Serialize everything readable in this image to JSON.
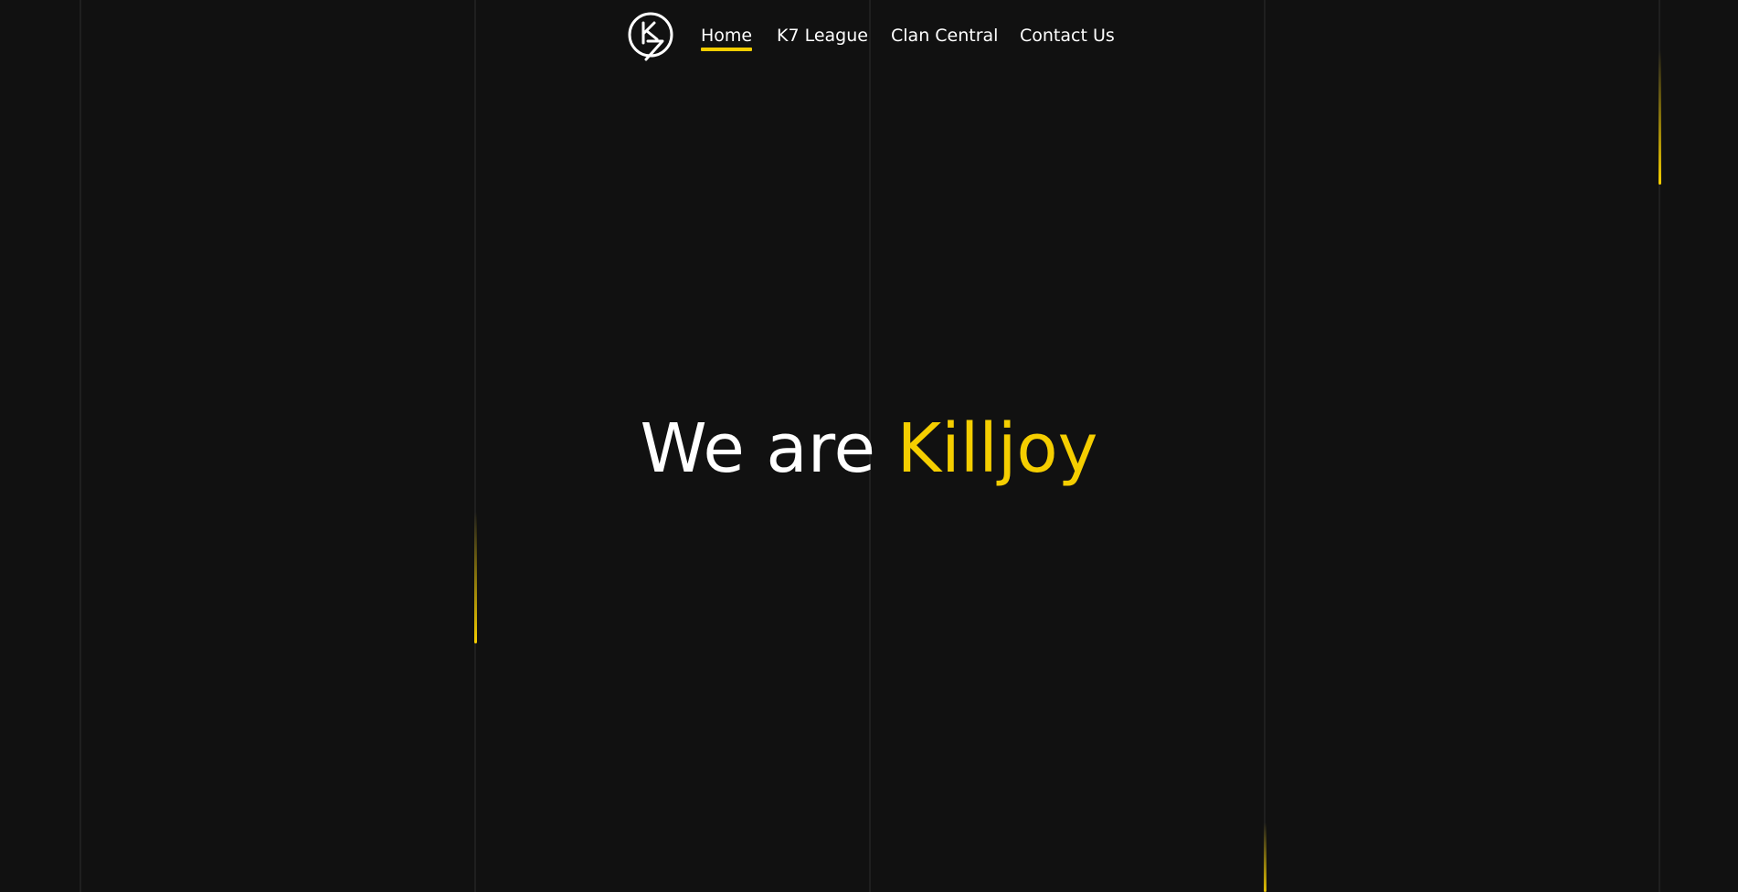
{
  "nav": {
    "logo_text": "K7",
    "links": [
      {
        "label": "Home",
        "active": true
      },
      {
        "label": "K7 League",
        "active": false
      },
      {
        "label": "Clan Central",
        "active": false
      },
      {
        "label": "Contact Us",
        "active": false
      }
    ]
  },
  "hero": {
    "prefix": "We are",
    "highlight": "Killjoy"
  },
  "colors": {
    "background": "#111111",
    "accent": "#f5ce00",
    "text": "#ffffff",
    "grid_line": "#1f1f1f"
  }
}
